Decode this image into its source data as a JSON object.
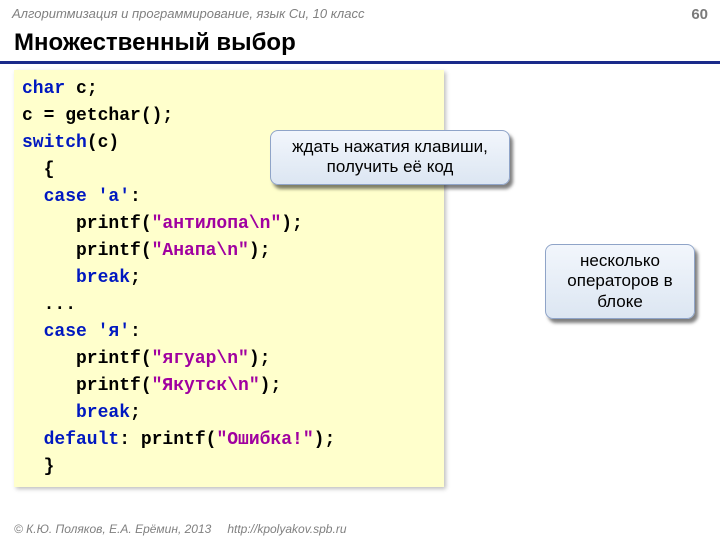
{
  "header": {
    "subject": "Алгоритмизация и программирование, язык Си, 10 класс",
    "page_number": "60"
  },
  "title": "Множественный выбор",
  "callouts": {
    "wait_key": "ждать нажатия клавиши, получить её код",
    "multi_ops": "несколько операторов в блоке"
  },
  "code": {
    "l1_kw": "char",
    "l1_rest": " c;",
    "l2": "c = getchar();",
    "l3_kw": "switch",
    "l3_rest": "(c)",
    "l4": "  {",
    "l5_kw": "  case ",
    "l5_chr": "'а'",
    "l5_rest": ":",
    "l6_pre": "     printf(",
    "l6_str": "\"антилопа\\n\"",
    "l6_post": ");",
    "l7_pre": "     printf(",
    "l7_str": "\"Анапа\\n\"",
    "l7_post": ");",
    "l8_kw": "     break",
    "l8_rest": ";",
    "l9": "  ...",
    "l10_kw": "  case ",
    "l10_chr": "'я'",
    "l10_rest": ":",
    "l11_pre": "     printf(",
    "l11_str": "\"ягуар\\n\"",
    "l11_post": ");",
    "l12_pre": "     printf(",
    "l12_str": "\"Якутск\\n\"",
    "l12_post": ");",
    "l13_kw": "     break",
    "l13_rest": ";",
    "l14_kw": "  default",
    "l14_mid": ": printf(",
    "l14_str": "\"Ошибка!\"",
    "l14_post": ");",
    "l15": "  }"
  },
  "footer": {
    "copyright": "© К.Ю. Поляков, Е.А. Ерёмин, 2013",
    "url": "http://kpolyakov.spb.ru"
  }
}
